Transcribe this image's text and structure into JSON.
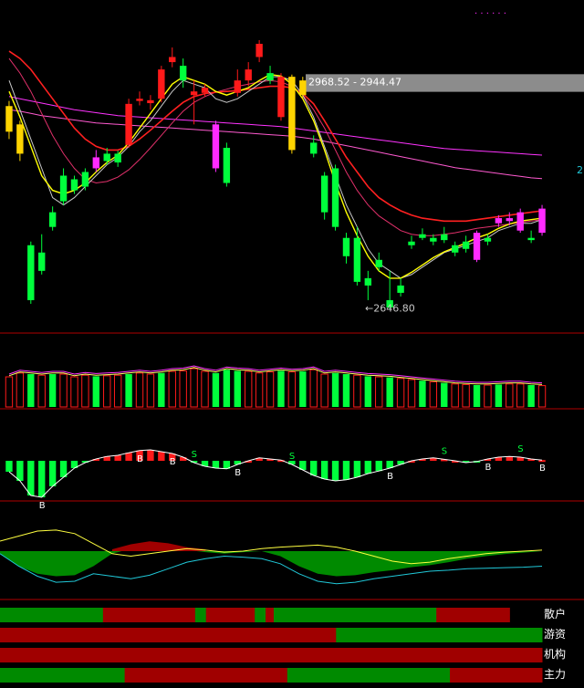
{
  "colors": {
    "background": "#000000",
    "up": "#ff1a1a",
    "down": "#00ff3c",
    "yellow_candle": "#ffd400",
    "magenta_candle": "#ff2bff",
    "ma_white": "#c8c8c8",
    "ma_yellow": "#ffff00",
    "ma_red": "#ff2020",
    "ma_magenta": "#ff33ff",
    "divider": "#b00000",
    "flow_red": "#a00000",
    "flow_green": "#008a00",
    "zone_gray": "#8c8c8c",
    "cyan": "#20c8d8"
  },
  "main_chart": {
    "top_dots": "· · · · · ·",
    "zone_label": "2968.52 - 2944.47",
    "low_label": "2646.80",
    "right_edge_mark": "2",
    "candles": [
      {
        "o": 2925,
        "c": 2890,
        "h": 2932,
        "l": 2880,
        "k": "yellow"
      },
      {
        "o": 2900,
        "c": 2860,
        "h": 2905,
        "l": 2850,
        "k": "yellow"
      },
      {
        "o": 2660,
        "c": 2735,
        "h": 2740,
        "l": 2655,
        "k": "down"
      },
      {
        "o": 2700,
        "c": 2725,
        "h": 2750,
        "l": 2695,
        "k": "down"
      },
      {
        "o": 2760,
        "c": 2780,
        "h": 2788,
        "l": 2755,
        "k": "down"
      },
      {
        "o": 2795,
        "c": 2830,
        "h": 2840,
        "l": 2790,
        "k": "down"
      },
      {
        "o": 2810,
        "c": 2825,
        "h": 2830,
        "l": 2805,
        "k": "down"
      },
      {
        "o": 2815,
        "c": 2835,
        "h": 2840,
        "l": 2810,
        "k": "down"
      },
      {
        "o": 2840,
        "c": 2855,
        "h": 2865,
        "l": 2835,
        "k": "magenta"
      },
      {
        "o": 2850,
        "c": 2860,
        "h": 2868,
        "l": 2845,
        "k": "down"
      },
      {
        "o": 2860,
        "c": 2848,
        "h": 2864,
        "l": 2842,
        "k": "down"
      },
      {
        "o": 2872,
        "c": 2928,
        "h": 2935,
        "l": 2868,
        "k": "up"
      },
      {
        "o": 2932,
        "c": 2935,
        "h": 2945,
        "l": 2926,
        "k": "up"
      },
      {
        "o": 2929,
        "c": 2933,
        "h": 2940,
        "l": 2920,
        "k": "up"
      },
      {
        "o": 2935,
        "c": 2975,
        "h": 2980,
        "l": 2930,
        "k": "up"
      },
      {
        "o": 2985,
        "c": 2992,
        "h": 3005,
        "l": 2978,
        "k": "up"
      },
      {
        "o": 2980,
        "c": 2960,
        "h": 2990,
        "l": 2950,
        "k": "down"
      },
      {
        "o": 2945,
        "c": 2940,
        "h": 2960,
        "l": 2900,
        "k": "up"
      },
      {
        "o": 2950,
        "c": 2943,
        "h": 2955,
        "l": 2938,
        "k": "up"
      },
      {
        "o": 2840,
        "c": 2900,
        "h": 2905,
        "l": 2835,
        "k": "magenta"
      },
      {
        "o": 2820,
        "c": 2868,
        "h": 2875,
        "l": 2815,
        "k": "down"
      },
      {
        "o": 2943,
        "c": 2960,
        "h": 2975,
        "l": 2938,
        "k": "up"
      },
      {
        "o": 2960,
        "c": 2975,
        "h": 2985,
        "l": 2952,
        "k": "up"
      },
      {
        "o": 2992,
        "c": 3010,
        "h": 3015,
        "l": 2985,
        "k": "up"
      },
      {
        "o": 2970,
        "c": 2960,
        "h": 2980,
        "l": 2955,
        "k": "down"
      },
      {
        "o": 2910,
        "c": 2965,
        "h": 2970,
        "l": 2905,
        "k": "up"
      },
      {
        "o": 2965,
        "c": 2865,
        "h": 2968,
        "l": 2860,
        "k": "yellow"
      },
      {
        "o": 2940,
        "c": 2960,
        "h": 2965,
        "l": 2935,
        "k": "yellow"
      },
      {
        "o": 2860,
        "c": 2875,
        "h": 2885,
        "l": 2855,
        "k": "down"
      },
      {
        "o": 2830,
        "c": 2780,
        "h": 2835,
        "l": 2770,
        "k": "down"
      },
      {
        "o": 2840,
        "c": 2760,
        "h": 2845,
        "l": 2755,
        "k": "down"
      },
      {
        "o": 2720,
        "c": 2745,
        "h": 2752,
        "l": 2710,
        "k": "down"
      },
      {
        "o": 2745,
        "c": 2685,
        "h": 2760,
        "l": 2680,
        "k": "down"
      },
      {
        "o": 2690,
        "c": 2680,
        "h": 2700,
        "l": 2660,
        "k": "down"
      },
      {
        "o": 2715,
        "c": 2705,
        "h": 2725,
        "l": 2700,
        "k": "down"
      },
      {
        "o": 2660,
        "c": 2650,
        "h": 2700,
        "l": 2647,
        "k": "down"
      },
      {
        "o": 2680,
        "c": 2670,
        "h": 2690,
        "l": 2665,
        "k": "down"
      },
      {
        "o": 2740,
        "c": 2735,
        "h": 2748,
        "l": 2730,
        "k": "down"
      },
      {
        "o": 2750,
        "c": 2745,
        "h": 2758,
        "l": 2742,
        "k": "down"
      },
      {
        "o": 2740,
        "c": 2745,
        "h": 2750,
        "l": 2735,
        "k": "down"
      },
      {
        "o": 2750,
        "c": 2742,
        "h": 2760,
        "l": 2738,
        "k": "down"
      },
      {
        "o": 2735,
        "c": 2725,
        "h": 2740,
        "l": 2720,
        "k": "down"
      },
      {
        "o": 2730,
        "c": 2740,
        "h": 2748,
        "l": 2725,
        "k": "down"
      },
      {
        "o": 2715,
        "c": 2752,
        "h": 2755,
        "l": 2712,
        "k": "magenta"
      },
      {
        "o": 2745,
        "c": 2740,
        "h": 2750,
        "l": 2735,
        "k": "down"
      },
      {
        "o": 2765,
        "c": 2772,
        "h": 2776,
        "l": 2760,
        "k": "magenta"
      },
      {
        "o": 2768,
        "c": 2772,
        "h": 2780,
        "l": 2762,
        "k": "magenta"
      },
      {
        "o": 2755,
        "c": 2780,
        "h": 2785,
        "l": 2752,
        "k": "magenta"
      },
      {
        "o": 2742,
        "c": 2745,
        "h": 2755,
        "l": 2738,
        "k": "down"
      },
      {
        "o": 2752,
        "c": 2785,
        "h": 2790,
        "l": 2748,
        "k": "magenta"
      }
    ],
    "ma_white": [
      2960,
      2920,
      2880,
      2840,
      2800,
      2790,
      2800,
      2815,
      2830,
      2845,
      2855,
      2870,
      2890,
      2905,
      2925,
      2945,
      2960,
      2955,
      2950,
      2935,
      2930,
      2935,
      2945,
      2955,
      2965,
      2965,
      2960,
      2940,
      2910,
      2870,
      2830,
      2790,
      2760,
      2730,
      2710,
      2700,
      2690,
      2695,
      2705,
      2715,
      2725,
      2730,
      2735,
      2740,
      2745,
      2755,
      2760,
      2765,
      2765,
      2770
    ],
    "ma_yellow": [
      2945,
      2910,
      2870,
      2830,
      2810,
      2805,
      2810,
      2820,
      2835,
      2848,
      2858,
      2875,
      2895,
      2915,
      2935,
      2955,
      2965,
      2960,
      2955,
      2945,
      2940,
      2945,
      2950,
      2960,
      2968,
      2966,
      2955,
      2935,
      2905,
      2865,
      2820,
      2780,
      2748,
      2720,
      2700,
      2690,
      2690,
      2698,
      2708,
      2718,
      2726,
      2732,
      2738,
      2745,
      2750,
      2758,
      2764,
      2768,
      2770,
      2772
    ],
    "ma_red": [
      3000,
      2990,
      2975,
      2955,
      2935,
      2915,
      2895,
      2880,
      2870,
      2865,
      2865,
      2870,
      2880,
      2892,
      2905,
      2918,
      2930,
      2938,
      2942,
      2944,
      2945,
      2946,
      2948,
      2950,
      2952,
      2952,
      2950,
      2942,
      2928,
      2905,
      2880,
      2855,
      2835,
      2815,
      2800,
      2790,
      2782,
      2776,
      2772,
      2770,
      2768,
      2768,
      2768,
      2770,
      2772,
      2774,
      2776,
      2778,
      2780,
      2782
    ],
    "ma_magenta": [
      2990,
      2970,
      2945,
      2915,
      2885,
      2860,
      2840,
      2825,
      2820,
      2822,
      2828,
      2838,
      2852,
      2868,
      2885,
      2902,
      2918,
      2930,
      2938,
      2944,
      2948,
      2952,
      2955,
      2958,
      2960,
      2958,
      2952,
      2940,
      2920,
      2895,
      2865,
      2835,
      2810,
      2790,
      2775,
      2765,
      2755,
      2750,
      2748,
      2748,
      2750,
      2752,
      2755,
      2758,
      2760,
      2762,
      2764,
      2766,
      2768,
      2770
    ],
    "ma_flat": [
      2920,
      2918,
      2915,
      2912,
      2910,
      2908,
      2906,
      2904,
      2902,
      2901,
      2900,
      2899,
      2898,
      2897,
      2896,
      2895,
      2894,
      2893,
      2892,
      2891,
      2890,
      2889,
      2888,
      2887,
      2886,
      2885,
      2884,
      2882,
      2880,
      2877,
      2874,
      2871,
      2868,
      2865,
      2862,
      2859,
      2856,
      2853,
      2850,
      2847,
      2844,
      2841,
      2839,
      2837,
      2835,
      2833,
      2831,
      2829,
      2827,
      2826
    ],
    "ma_flat2": [
      2938,
      2935,
      2932,
      2929,
      2926,
      2923,
      2920,
      2918,
      2916,
      2914,
      2912,
      2911,
      2910,
      2909,
      2908,
      2907,
      2906,
      2905,
      2904,
      2903,
      2902,
      2901,
      2900,
      2899,
      2898,
      2897,
      2895,
      2893,
      2891,
      2889,
      2887,
      2885,
      2883,
      2881,
      2879,
      2877,
      2875,
      2873,
      2871,
      2869,
      2867,
      2866,
      2865,
      2864,
      2863,
      2862,
      2861,
      2860,
      2859,
      2858
    ]
  },
  "volume": [
    0.55,
    0.62,
    0.6,
    0.58,
    0.6,
    0.6,
    0.55,
    0.58,
    0.56,
    0.57,
    0.58,
    0.6,
    0.62,
    0.6,
    0.62,
    0.65,
    0.66,
    0.7,
    0.65,
    0.62,
    0.68,
    0.66,
    0.65,
    0.62,
    0.64,
    0.66,
    0.64,
    0.65,
    0.68,
    0.6,
    0.62,
    0.6,
    0.58,
    0.56,
    0.55,
    0.54,
    0.52,
    0.5,
    0.48,
    0.46,
    0.44,
    0.42,
    0.41,
    0.4,
    0.4,
    0.41,
    0.42,
    0.42,
    0.4,
    0.39
  ],
  "volume_hollow": [
    1,
    1,
    0,
    1,
    0,
    1,
    1,
    1,
    0,
    1,
    1,
    0,
    1,
    1,
    0,
    1,
    1,
    1,
    1,
    0,
    0,
    0,
    1,
    1,
    1,
    0,
    1,
    0,
    1,
    1,
    0,
    0,
    1,
    0,
    1,
    0,
    1,
    1,
    0,
    1,
    0,
    1,
    1,
    0,
    1,
    0,
    1,
    1,
    0,
    1
  ],
  "oscillator": {
    "values": [
      -0.3,
      -0.55,
      -0.95,
      -1.0,
      -0.7,
      -0.45,
      -0.2,
      -0.05,
      0.05,
      0.12,
      0.15,
      0.22,
      0.28,
      0.3,
      0.25,
      0.2,
      0.1,
      -0.05,
      -0.15,
      -0.2,
      -0.22,
      -0.1,
      0.0,
      0.08,
      0.05,
      0.02,
      -0.1,
      -0.25,
      -0.4,
      -0.5,
      -0.55,
      -0.52,
      -0.45,
      -0.35,
      -0.28,
      -0.2,
      -0.1,
      0.0,
      0.05,
      0.08,
      0.04,
      0.0,
      -0.05,
      -0.02,
      0.05,
      0.1,
      0.12,
      0.1,
      0.05,
      0.02
    ],
    "markers": [
      {
        "i": 3,
        "t": "B"
      },
      {
        "i": 12,
        "t": "B"
      },
      {
        "i": 15,
        "t": "B"
      },
      {
        "i": 17,
        "t": "S"
      },
      {
        "i": 21,
        "t": "B"
      },
      {
        "i": 26,
        "t": "S"
      },
      {
        "i": 35,
        "t": "B"
      },
      {
        "i": 40,
        "t": "S"
      },
      {
        "i": 44,
        "t": "B"
      },
      {
        "i": 47,
        "t": "S"
      },
      {
        "i": 49,
        "t": "B"
      }
    ]
  },
  "flow_panel": {
    "yellow": [
      0.2,
      0.3,
      0.4,
      0.42,
      0.35,
      0.15,
      -0.05,
      -0.1,
      -0.05,
      0.0,
      0.05,
      0.02,
      -0.02,
      0.0,
      0.05,
      0.08,
      0.1,
      0.12,
      0.08,
      0.0,
      -0.1,
      -0.2,
      -0.25,
      -0.22,
      -0.15,
      -0.1,
      -0.05,
      -0.02,
      0.0,
      0.02
    ],
    "cyan": [
      -0.05,
      -0.3,
      -0.5,
      -0.62,
      -0.6,
      -0.45,
      -0.5,
      -0.55,
      -0.48,
      -0.35,
      -0.22,
      -0.15,
      -0.1,
      -0.12,
      -0.15,
      -0.25,
      -0.45,
      -0.6,
      -0.65,
      -0.62,
      -0.55,
      -0.5,
      -0.45,
      -0.4,
      -0.38,
      -0.35,
      -0.34,
      -0.33,
      -0.32,
      -0.3
    ],
    "fill": [
      -0.05,
      -0.3,
      -0.45,
      -0.5,
      -0.48,
      -0.3,
      -0.05,
      0.05,
      0.08,
      0.06,
      0.02,
      -0.02,
      -0.05,
      -0.02,
      0.0,
      -0.1,
      -0.3,
      -0.45,
      -0.5,
      -0.48,
      -0.42,
      -0.38,
      -0.32,
      -0.28,
      -0.22,
      -0.15,
      -0.1,
      -0.06,
      -0.03,
      0.0
    ]
  },
  "bars": {
    "labels": [
      "散户",
      "游资",
      "机构",
      "主力"
    ],
    "segments": [
      [
        [
          "g",
          0.19
        ],
        [
          "r",
          0.17
        ],
        [
          "g",
          0.02
        ],
        [
          "r",
          0.09
        ],
        [
          "g",
          0.02
        ],
        [
          "r",
          0.015
        ],
        [
          "g",
          0.3
        ],
        [
          "r",
          0.135
        ]
      ],
      [
        [
          "r",
          0.62
        ],
        [
          "g",
          0.38
        ]
      ],
      [
        [
          "r",
          1.0
        ]
      ],
      [
        [
          "g",
          0.23
        ],
        [
          "r",
          0.3
        ],
        [
          "g",
          0.3
        ],
        [
          "r",
          0.17
        ]
      ]
    ]
  }
}
